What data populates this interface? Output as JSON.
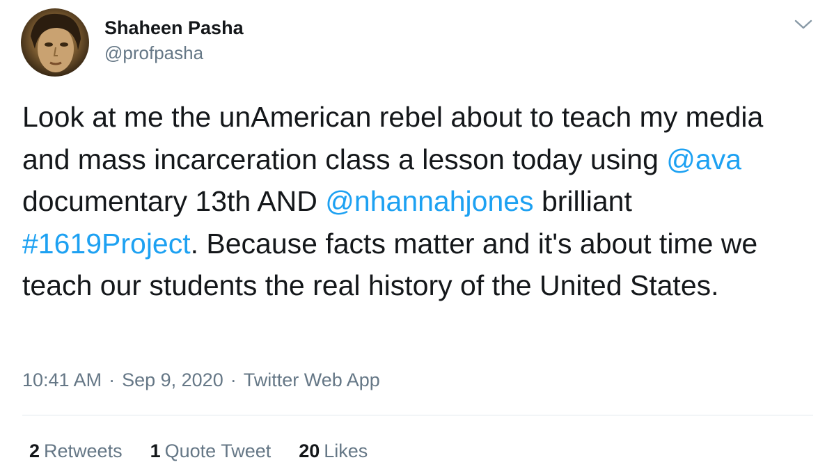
{
  "author": {
    "display_name": "Shaheen Pasha",
    "handle": "@profpasha"
  },
  "icons": {
    "menu": "chevron-down-icon",
    "avatar": "profile-photo"
  },
  "colors": {
    "link": "#1da1f2",
    "text": "#14171a",
    "secondary": "#657786",
    "divider": "#e1e8ed"
  },
  "tweet": {
    "segments": [
      {
        "text": "Look at me the unAmerican rebel about to teach my media and mass incarceration class a lesson today using ",
        "link": false
      },
      {
        "text": "@ava",
        "link": true
      },
      {
        "text": " documentary 13th AND ",
        "link": false
      },
      {
        "text": "@nhannahjones",
        "link": true
      },
      {
        "text": " brilliant ",
        "link": false
      },
      {
        "text": "#1619Project",
        "link": true
      },
      {
        "text": ". Because facts matter and it's about time we teach our students the real history of the United States.",
        "link": false
      }
    ]
  },
  "meta": {
    "time": "10:41 AM",
    "separator": "·",
    "date": "Sep 9, 2020",
    "source": "Twitter Web App"
  },
  "stats": {
    "retweets_count": "2",
    "retweets_label": "Retweets",
    "quotes_count": "1",
    "quotes_label": "Quote Tweet",
    "likes_count": "20",
    "likes_label": "Likes"
  }
}
